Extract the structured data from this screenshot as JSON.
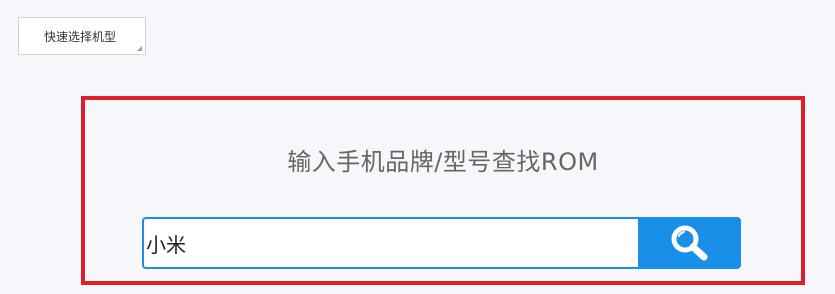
{
  "quick_select": {
    "label": "快速选择机型"
  },
  "search": {
    "title": "输入手机品牌/型号查找ROM",
    "input_value": "小米",
    "button_icon": "search-icon"
  },
  "colors": {
    "highlight_border": "#e01e2a",
    "accent": "#1a8fe8",
    "background": "#f5f7fa"
  }
}
